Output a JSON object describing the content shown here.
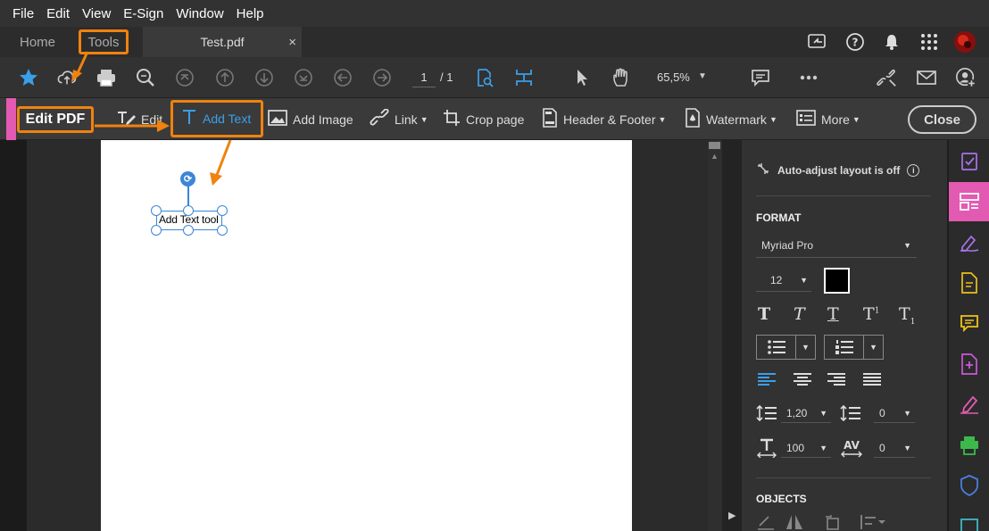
{
  "menu": [
    "File",
    "Edit",
    "View",
    "E-Sign",
    "Window",
    "Help"
  ],
  "tabs": {
    "home": "Home",
    "tools": "Tools",
    "document": "Test.pdf",
    "close_glyph": "×"
  },
  "toolbar": {
    "page_current": "1",
    "page_total": "/ 1",
    "zoom": "65,5%"
  },
  "editbar": {
    "title": "Edit PDF",
    "items": [
      "Edit",
      "Add Text",
      "Add Image",
      "Link",
      "Crop page",
      "Header & Footer",
      "Watermark",
      "More"
    ],
    "close": "Close"
  },
  "document": {
    "textbox_text": "Add Text tool"
  },
  "panel": {
    "autoadjust": "Auto-adjust layout is off",
    "format_title": "FORMAT",
    "font": "Myriad Pro",
    "font_size": "12",
    "color": "#000000",
    "line_spacing": "1,20",
    "para_spacing": "0",
    "h_scale": "100",
    "char_spacing": "0",
    "objects_title": "OBJECTS"
  },
  "colors": {
    "accent": "#f0820f",
    "pink": "#e25ab2",
    "blue": "#3b9fe8"
  }
}
